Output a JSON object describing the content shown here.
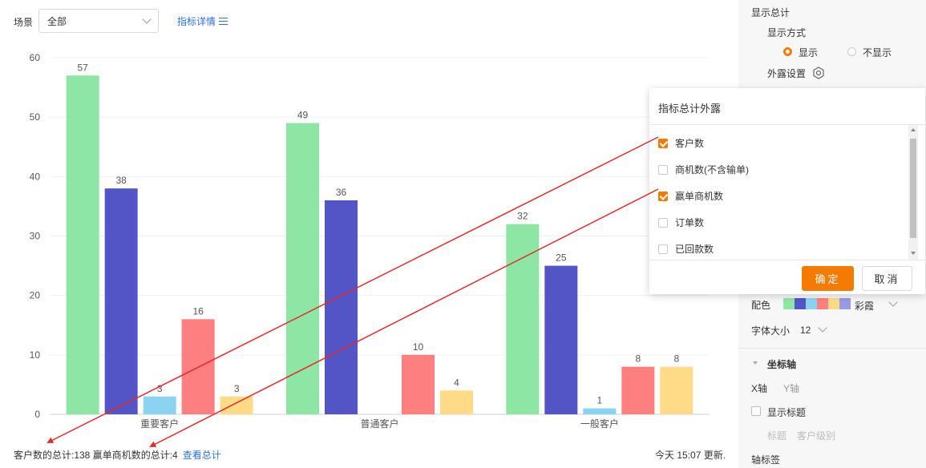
{
  "toolbar": {
    "scene_label": "场景",
    "scene_value": "全部",
    "detail_link": "指标详情"
  },
  "footer": {
    "total_text": "客户数的总计:138  赢单商机数的总计:4",
    "view_total": "查看总计",
    "update_time": "今天 15:07 更新."
  },
  "chart_data": {
    "type": "bar",
    "categories": [
      "重要客户",
      "普通客户",
      "一般客户"
    ],
    "series": [
      {
        "values": [
          57,
          49,
          32
        ],
        "color": "#8ee6a5"
      },
      {
        "values": [
          38,
          36,
          25
        ],
        "color": "#5355c6"
      },
      {
        "values": [
          3,
          null,
          1
        ],
        "color": "#8cd3f1"
      },
      {
        "values": [
          16,
          10,
          8
        ],
        "color": "#fd7f7f"
      },
      {
        "values": [
          3,
          4,
          8
        ],
        "color": "#ffdb88"
      }
    ],
    "ylim": [
      0,
      60
    ],
    "yticks": [
      0,
      10,
      20,
      30,
      40,
      50,
      60
    ],
    "grid": true
  },
  "panel": {
    "show_total": "显示总计",
    "display_mode": "显示方式",
    "opt_show": "显示",
    "opt_hide": "不显示",
    "exposure_setting": "外露设置",
    "color_label": "配色",
    "color_scheme": "彩霞",
    "palette": [
      "#8ee6a5",
      "#5355c6",
      "#8cd3f1",
      "#fd7f7f",
      "#ffdb88",
      "#9999e6"
    ],
    "font_size_label": "字体大小",
    "font_size_value": "12",
    "axis_section": "坐标轴",
    "x_axis": "X轴",
    "y_axis": "Y轴",
    "show_title": "显示标题",
    "title_label": "标题",
    "title_placeholder": "客户级别",
    "axis_tick_label": "轴标签"
  },
  "popup": {
    "title": "指标总计外露",
    "options": [
      {
        "label": "客户数",
        "checked": true
      },
      {
        "label": "商机数(不含输单)",
        "checked": false
      },
      {
        "label": "赢单商机数",
        "checked": true
      },
      {
        "label": "订单数",
        "checked": false
      },
      {
        "label": "已回款数",
        "checked": false
      }
    ],
    "confirm": "确定",
    "cancel": "取消"
  },
  "accent_color": "#f57b00",
  "link_color": "#2f6fde",
  "annotation_color": "#e52a2a"
}
